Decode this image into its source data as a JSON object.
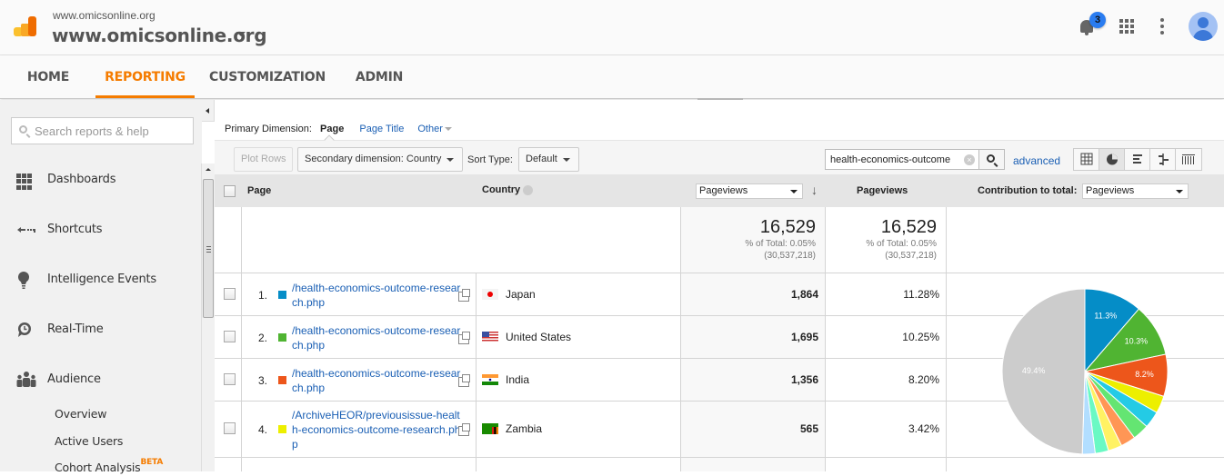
{
  "header": {
    "account_small": "www.omicsonline.org",
    "account_title": "www.omicsonline.org",
    "notification_count": "3",
    "icons": [
      "analytics-logo-icon",
      "bell-icon",
      "apps-grid-icon",
      "kebab-menu-icon",
      "avatar-icon"
    ]
  },
  "nav": {
    "tabs": [
      {
        "label": "HOME",
        "active": false
      },
      {
        "label": "REPORTING",
        "active": true
      },
      {
        "label": "CUSTOMIZATION",
        "active": false
      },
      {
        "label": "ADMIN",
        "active": false
      }
    ],
    "accent": "#f57c00"
  },
  "sidebar": {
    "search_placeholder": "Search reports & help",
    "items": [
      {
        "label": "Dashboards",
        "icon": "dashboard-grid-icon"
      },
      {
        "label": "Shortcuts",
        "icon": "shortcut-arrow-icon"
      },
      {
        "label": "Intelligence Events",
        "icon": "lightbulb-icon"
      },
      {
        "label": "Real-Time",
        "icon": "clock-icon"
      },
      {
        "label": "Audience",
        "icon": "people-icon"
      }
    ],
    "sub_items": [
      {
        "label": "Overview"
      },
      {
        "label": "Active Users"
      },
      {
        "label": "Cohort Analysis",
        "badge": "BETA"
      }
    ]
  },
  "report": {
    "primary_dimension_label": "Primary Dimension:",
    "primary_dimension_active": "Page",
    "primary_dimension_options": [
      "Page Title",
      "Other"
    ],
    "plot_rows_label": "Plot Rows",
    "secondary_dimension_label": "Secondary dimension: Country",
    "sort_type_label": "Sort Type:",
    "sort_type_value": "Default",
    "filter_value": "health-economics-outcome",
    "advanced_label": "advanced",
    "view_modes": [
      "table-view-icon",
      "pie-view-icon",
      "performance-view-icon",
      "comparison-view-icon",
      "pivot-view-icon"
    ],
    "active_view": "pie-view-icon"
  },
  "table": {
    "columns": {
      "page": "Page",
      "country": "Country",
      "metric_select": "Pageviews",
      "pageviews": "Pageviews",
      "contribution_label": "Contribution to total:",
      "contribution_select": "Pageviews"
    },
    "totals": {
      "value": "16,529",
      "pct_of_total": "% of Total: 0.05%",
      "site_total": "(30,537,218)",
      "value2": "16,529",
      "pct_of_total2": "% of Total: 0.05%",
      "site_total2": "(30,537,218)"
    },
    "rows": [
      {
        "num": "1.",
        "color": "#058dc7",
        "page": "/health-economics-outcome-research.php",
        "country": "Japan",
        "pageviews": "1,864",
        "pct": "11.28%"
      },
      {
        "num": "2.",
        "color": "#50b432",
        "page": "/health-economics-outcome-research.php",
        "country": "United States",
        "pageviews": "1,695",
        "pct": "10.25%"
      },
      {
        "num": "3.",
        "color": "#ed561b",
        "page": "/health-economics-outcome-research.php",
        "country": "India",
        "pageviews": "1,356",
        "pct": "8.20%"
      },
      {
        "num": "4.",
        "color": "#edef00",
        "page": "/ArchiveHEOR/previousissue-health-economics-outcome-research.php",
        "country": "Zambia",
        "pageviews": "565",
        "pct": "3.42%"
      }
    ]
  },
  "chart_data": {
    "type": "pie",
    "title": "Contribution to total: Pageviews",
    "slices": [
      {
        "label": "Japan",
        "value": 11.3,
        "color": "#058dc7",
        "show_label": true
      },
      {
        "label": "United States",
        "value": 10.3,
        "color": "#50b432",
        "show_label": true
      },
      {
        "label": "India",
        "value": 8.2,
        "color": "#ed561b",
        "show_label": true
      },
      {
        "label": "Zambia",
        "value": 3.4,
        "color": "#edef00",
        "show_label": false
      },
      {
        "label": "row 5",
        "value": 3.3,
        "color": "#24cbe5",
        "show_label": false
      },
      {
        "label": "row 6",
        "value": 3.2,
        "color": "#64e572",
        "show_label": false
      },
      {
        "label": "row 7",
        "value": 2.9,
        "color": "#ff9655",
        "show_label": false
      },
      {
        "label": "row 8",
        "value": 2.7,
        "color": "#fff263",
        "show_label": false
      },
      {
        "label": "row 9",
        "value": 2.6,
        "color": "#6af9c4",
        "show_label": false
      },
      {
        "label": "row 10",
        "value": 2.5,
        "color": "#b2deff",
        "show_label": false
      },
      {
        "label": "Other",
        "value": 49.4,
        "color": "#cccccc",
        "show_label": true
      }
    ]
  }
}
